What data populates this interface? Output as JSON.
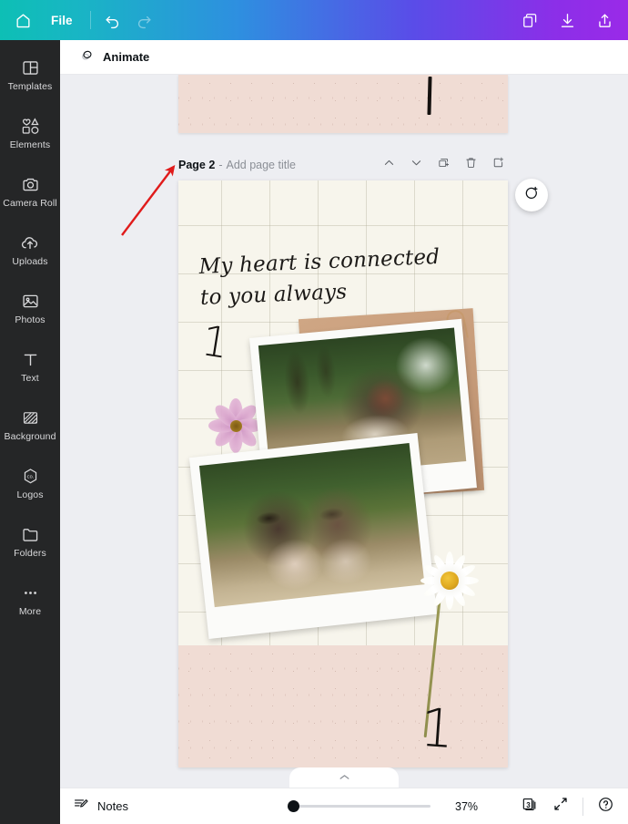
{
  "topbar": {
    "home_icon": "home-icon",
    "file_label": "File",
    "undo_icon": "undo-icon",
    "redo_icon": "redo-icon",
    "duplicate_icon": "duplicate-icon",
    "download_icon": "download-icon",
    "share_icon": "share-icon",
    "gradient_start": "#0dbfb5",
    "gradient_end": "#9a2ae8"
  },
  "sidebar": {
    "background": "#252627",
    "items": [
      {
        "label": "Templates",
        "icon": "templates-icon"
      },
      {
        "label": "Elements",
        "icon": "elements-icon"
      },
      {
        "label": "Camera Roll",
        "icon": "camera-icon"
      },
      {
        "label": "Uploads",
        "icon": "upload-cloud-icon"
      },
      {
        "label": "Photos",
        "icon": "photos-icon"
      },
      {
        "label": "Text",
        "icon": "text-icon"
      },
      {
        "label": "Background",
        "icon": "background-icon"
      },
      {
        "label": "Logos",
        "icon": "logos-icon"
      },
      {
        "label": "Folders",
        "icon": "folder-icon"
      },
      {
        "label": "More",
        "icon": "more-dots-icon"
      }
    ]
  },
  "toolbar": {
    "animate_label": "Animate",
    "animate_icon": "animate-circle-icon"
  },
  "page_header": {
    "title": "Page 2",
    "separator": "-",
    "placeholder_title": "Add page title",
    "move_up_icon": "chevron-up-icon",
    "move_down_icon": "chevron-down-icon",
    "duplicate_page_icon": "duplicate-page-icon",
    "delete_page_icon": "trash-icon",
    "add_page_icon": "add-page-icon"
  },
  "canvas": {
    "paper_color": "#f7f5ec",
    "grid_line_color": "#b0ac98",
    "pink_color": "#f0dcd4",
    "script_text": "My heart is connected to you always",
    "mark_upper": "1",
    "mark_lower": "1",
    "prev_page_mark": "1",
    "comment_icon": "add-comment-icon",
    "annotation_arrow_color": "#e01b1b",
    "elements": {
      "tan_board": "tan-paper-board",
      "clip": "paper-clip",
      "photo_top": "polaroid-photo-woman-with-drink",
      "photo_bottom": "polaroid-photo-couple-sunglasses",
      "flower_left": "pink-cosmos-flower",
      "flower_right": "white-daisy-flower"
    }
  },
  "bottombar": {
    "notes_label": "Notes",
    "notes_icon": "notes-icon",
    "zoom_percent": "37%",
    "zoom_slider_value": 0,
    "page_count": "3",
    "page_count_icon": "pages-icon",
    "fullscreen_icon": "expand-icon",
    "help_icon": "help-icon",
    "collapse_icon": "chevron-up-icon"
  }
}
